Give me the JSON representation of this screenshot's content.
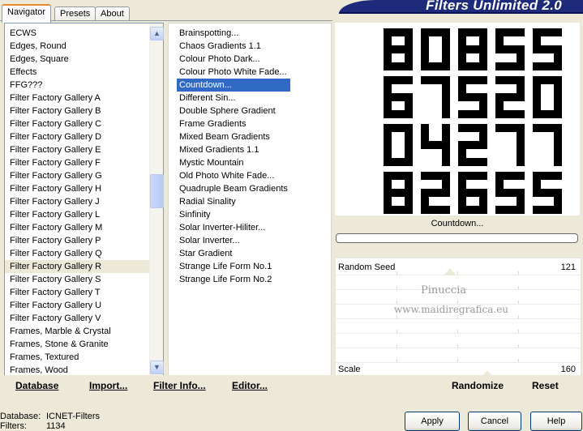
{
  "tabs": [
    {
      "label": "Navigator",
      "active": true
    },
    {
      "label": "Presets",
      "active": false
    },
    {
      "label": "About",
      "active": false
    }
  ],
  "banner": {
    "title": "Filters Unlimited 2.0"
  },
  "categories": [
    {
      "label": "ECWS"
    },
    {
      "label": "Edges, Round"
    },
    {
      "label": "Edges, Square"
    },
    {
      "label": "Effects"
    },
    {
      "label": "FFG???"
    },
    {
      "label": "Filter Factory Gallery A"
    },
    {
      "label": "Filter Factory Gallery B"
    },
    {
      "label": "Filter Factory Gallery C"
    },
    {
      "label": "Filter Factory Gallery D"
    },
    {
      "label": "Filter Factory Gallery E"
    },
    {
      "label": "Filter Factory Gallery F"
    },
    {
      "label": "Filter Factory Gallery G"
    },
    {
      "label": "Filter Factory Gallery H"
    },
    {
      "label": "Filter Factory Gallery J"
    },
    {
      "label": "Filter Factory Gallery L"
    },
    {
      "label": "Filter Factory Gallery M"
    },
    {
      "label": "Filter Factory Gallery P"
    },
    {
      "label": "Filter Factory Gallery Q"
    },
    {
      "label": "Filter Factory Gallery R",
      "selected": true
    },
    {
      "label": "Filter Factory Gallery S"
    },
    {
      "label": "Filter Factory Gallery T"
    },
    {
      "label": "Filter Factory Gallery U"
    },
    {
      "label": "Filter Factory Gallery V"
    },
    {
      "label": "Frames, Marble & Crystal"
    },
    {
      "label": "Frames, Stone & Granite"
    },
    {
      "label": "Frames, Textured"
    },
    {
      "label": "Frames, Wood"
    }
  ],
  "filters": [
    {
      "label": "Brainspotting..."
    },
    {
      "label": "Chaos Gradients 1.1"
    },
    {
      "label": "Colour Photo Dark..."
    },
    {
      "label": "Colour Photo White Fade..."
    },
    {
      "label": "Countdown...",
      "selected": true
    },
    {
      "label": "Different Sin..."
    },
    {
      "label": "Double Sphere Gradient"
    },
    {
      "label": "Frame Gradients"
    },
    {
      "label": "Mixed Beam Gradients"
    },
    {
      "label": "Mixed Gradients 1.1"
    },
    {
      "label": "Mystic Mountain"
    },
    {
      "label": "Old Photo White Fade..."
    },
    {
      "label": "Quadruple Beam Gradients"
    },
    {
      "label": "Radial Sinality"
    },
    {
      "label": "Sinfinity"
    },
    {
      "label": "Solar Inverter-Hiliter..."
    },
    {
      "label": "Solar Inverter..."
    },
    {
      "label": "Star Gradient"
    },
    {
      "label": "Strange Life Form No.1"
    },
    {
      "label": "Strange Life Form No.2"
    }
  ],
  "preview": {
    "digit_rows": [
      "80855",
      "67520",
      "04277",
      "82655"
    ],
    "filter_name": "Countdown..."
  },
  "params": {
    "random_seed": {
      "label": "Random Seed",
      "value": "121"
    },
    "scale": {
      "label": "Scale",
      "value": "160"
    }
  },
  "watermark": {
    "line1": "Pinuccia",
    "line2": "www.maidiregrafica.eu"
  },
  "toolbar": {
    "database": "Database",
    "import": "Import...",
    "filter_info": "Filter Info...",
    "editor": "Editor...",
    "randomize": "Randomize",
    "reset": "Reset"
  },
  "footer": {
    "database_label": "Database:",
    "database_value": "ICNET-Filters",
    "filters_label": "Filters:",
    "filters_value": "1134",
    "apply": "Apply",
    "cancel": "Cancel",
    "help": "Help"
  }
}
